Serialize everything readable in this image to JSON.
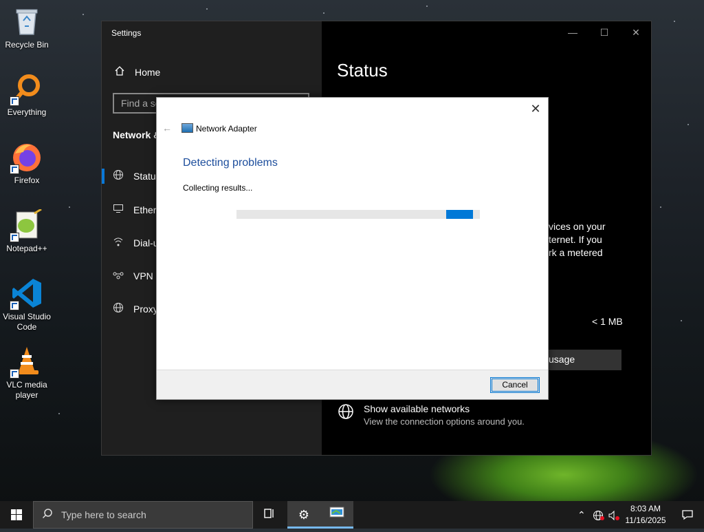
{
  "desktop": {
    "icons": [
      {
        "label": "Recycle Bin",
        "icon": "recycle-bin-icon"
      },
      {
        "label": "Everything",
        "icon": "search-magnifier-icon"
      },
      {
        "label": "Firefox",
        "icon": "firefox-icon"
      },
      {
        "label": "Notepad++",
        "icon": "notepad-plus-plus-icon"
      },
      {
        "label": "Visual Studio Code",
        "icon": "vscode-icon"
      },
      {
        "label": "VLC media player",
        "icon": "vlc-cone-icon"
      }
    ]
  },
  "settings": {
    "title": "Settings",
    "home_label": "Home",
    "search_placeholder": "Find a se",
    "section_title": "Network &",
    "nav_items": [
      {
        "label": "Statu",
        "icon": "globe-icon",
        "active": true
      },
      {
        "label": "Ether",
        "icon": "ethernet-monitor-icon"
      },
      {
        "label": "Dial-u",
        "icon": "dialup-icon"
      },
      {
        "label": "VPN",
        "icon": "vpn-icon"
      },
      {
        "label": "Proxy",
        "icon": "globe-icon"
      }
    ],
    "page_heading": "Status",
    "body_lines": [
      "vices on your",
      "ternet. If you",
      "rk a metered"
    ],
    "data_usage_value": "< 1 MB",
    "data_usage_button": "usage",
    "show_networks_title": "Show available networks",
    "show_networks_desc": "View the connection options around you."
  },
  "dialog": {
    "title": "Network Adapter",
    "heading": "Detecting problems",
    "status": "Collecting results...",
    "progress_marquee": true,
    "cancel_label": "Cancel",
    "close_glyph": "✕"
  },
  "taskbar": {
    "search_placeholder": "Type here to search",
    "time": "8:03 AM",
    "date": "11/16/2025",
    "accent": "#76b9ed"
  }
}
